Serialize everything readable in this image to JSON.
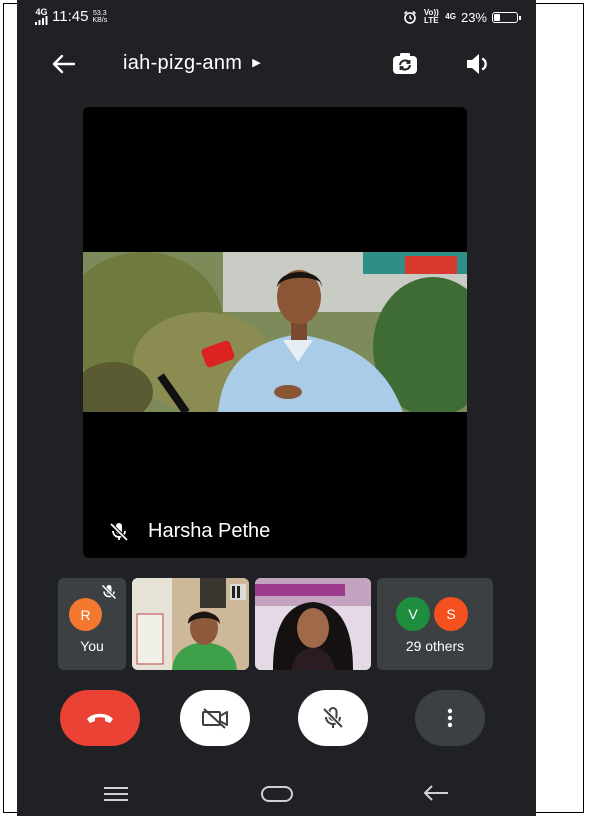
{
  "status_bar": {
    "network": "4G",
    "time": "11:45",
    "speed_value": "53.3",
    "speed_unit": "KB/s",
    "volte": "Vo)) LTE",
    "signal2": "4G",
    "battery": "23%",
    "battery_level": 0.23
  },
  "meeting": {
    "code": "iah-pizg-anm"
  },
  "stage": {
    "speaker_name": "Harsha Pethe"
  },
  "participants": {
    "you_initial": "R",
    "you_label": "You",
    "others_initials": [
      "V",
      "S"
    ],
    "others_label": "29 others"
  },
  "colors": {
    "background": "#202124",
    "tile": "#3c4043",
    "end_call": "#ea4335",
    "avatar_you": "#f4782f",
    "avatar_v": "#1e8e3e",
    "avatar_s": "#f4511e"
  },
  "icons": [
    "back-arrow-icon",
    "switch-camera-icon",
    "speaker-icon",
    "mic-off-icon",
    "end-call-icon",
    "video-off-icon",
    "more-vert-icon",
    "nav-menu-icon",
    "nav-home-icon",
    "nav-back-icon",
    "alarm-icon",
    "battery-icon"
  ]
}
